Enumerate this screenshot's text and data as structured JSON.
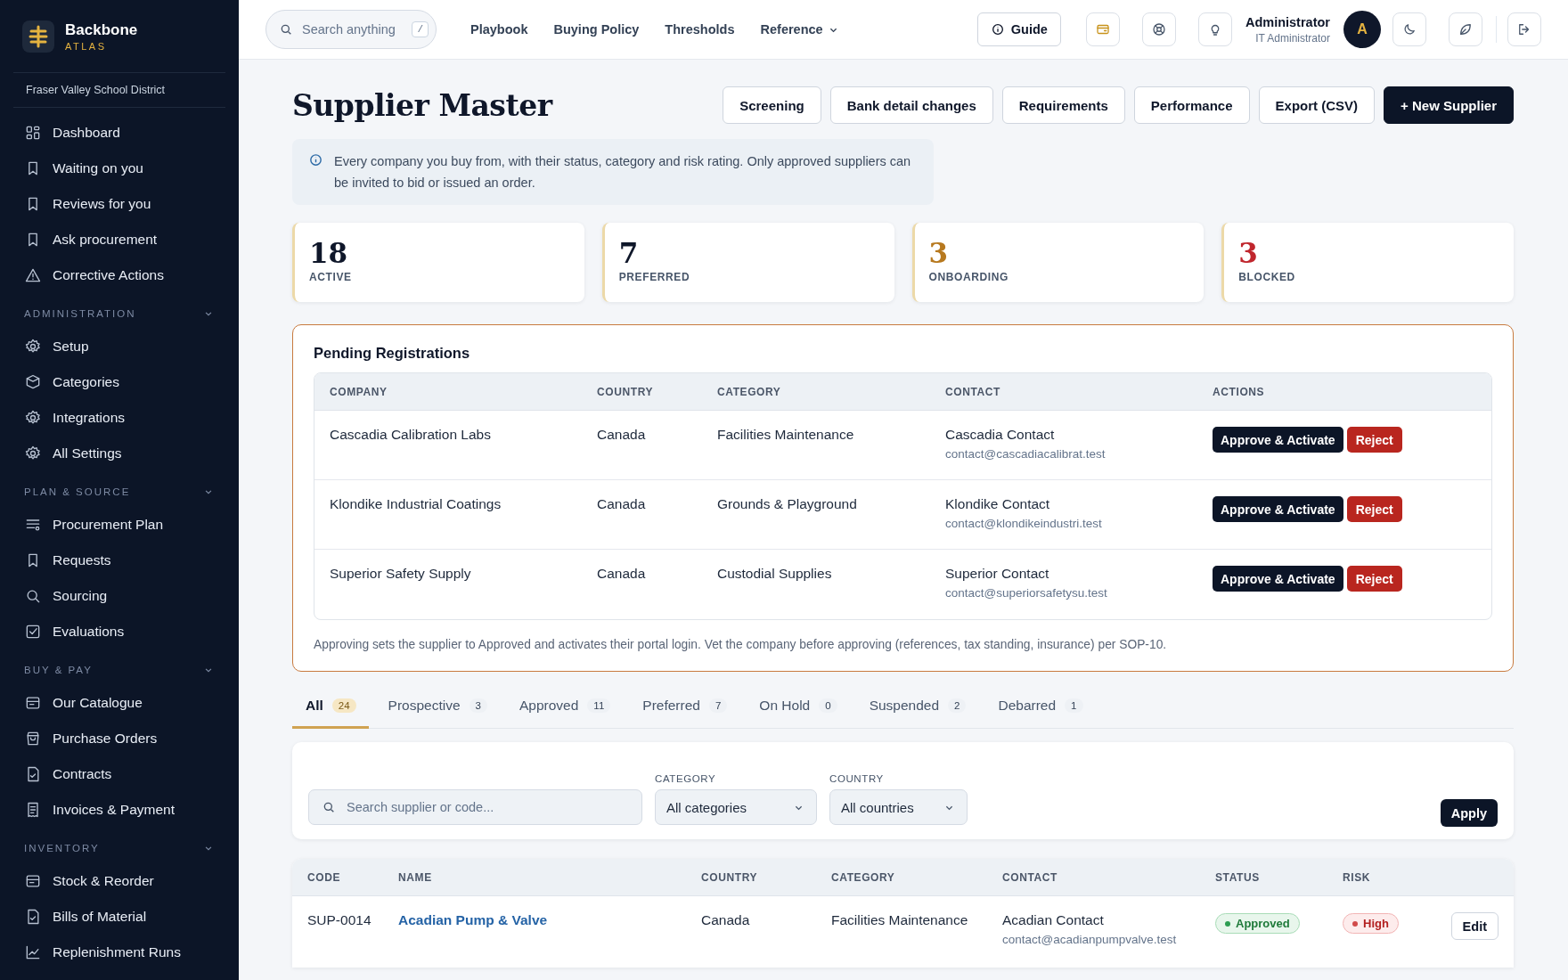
{
  "brand": {
    "name": "Backbone",
    "sub": "ATLAS"
  },
  "org": "Fraser Valley School District",
  "sidebar": {
    "items": [
      {
        "label": "Dashboard",
        "kind": "grid"
      },
      {
        "label": "Waiting on you",
        "kind": "bookmark"
      },
      {
        "label": "Reviews for you",
        "kind": "bookmark"
      },
      {
        "label": "Ask procurement",
        "kind": "bookmark"
      },
      {
        "label": "Corrective Actions",
        "kind": "alert"
      }
    ],
    "sections": [
      {
        "title": "ADMINISTRATION",
        "expanded": true,
        "items": [
          {
            "label": "Setup",
            "kind": "gear"
          },
          {
            "label": "Categories",
            "kind": "box"
          },
          {
            "label": "Integrations",
            "kind": "gear"
          },
          {
            "label": "All Settings",
            "kind": "gear"
          }
        ]
      },
      {
        "title": "PLAN & SOURCE",
        "expanded": true,
        "items": [
          {
            "label": "Procurement Plan",
            "kind": "list"
          },
          {
            "label": "Requests",
            "kind": "bookmark"
          },
          {
            "label": "Sourcing",
            "kind": "search"
          },
          {
            "label": "Evaluations",
            "kind": "check"
          }
        ]
      },
      {
        "title": "BUY & PAY",
        "expanded": true,
        "items": [
          {
            "label": "Our Catalogue",
            "kind": "card"
          },
          {
            "label": "Purchase Orders",
            "kind": "bag"
          },
          {
            "label": "Contracts",
            "kind": "doc"
          },
          {
            "label": "Invoices & Payment",
            "kind": "receipt"
          }
        ]
      },
      {
        "title": "INVENTORY",
        "expanded": true,
        "items": [
          {
            "label": "Stock & Reorder",
            "kind": "card"
          },
          {
            "label": "Bills of Material",
            "kind": "doc"
          },
          {
            "label": "Replenishment Runs",
            "kind": "chart"
          }
        ]
      }
    ]
  },
  "topbar": {
    "search": {
      "placeholder": "Search anything",
      "shortcut": "/"
    },
    "links": [
      {
        "label": "Playbook",
        "kind": "link"
      },
      {
        "label": "Buying Policy",
        "kind": "link"
      },
      {
        "label": "Thresholds",
        "kind": "link"
      },
      {
        "label": "Reference",
        "kind": "menu"
      }
    ],
    "guide": "Guide",
    "user": {
      "name": "Administrator",
      "role": "IT Administrator",
      "initial": "A"
    }
  },
  "page": {
    "title": "Supplier Master",
    "actions": [
      {
        "label": "Screening",
        "kind": "outline"
      },
      {
        "label": "Bank detail changes",
        "kind": "outline"
      },
      {
        "label": "Requirements",
        "kind": "outline"
      },
      {
        "label": "Performance",
        "kind": "outline"
      },
      {
        "label": "Export (CSV)",
        "kind": "outline"
      },
      {
        "label": "+ New Supplier",
        "kind": "primary"
      }
    ],
    "info": "Every company you buy from, with their status, category and risk rating. Only approved suppliers can be invited to bid or issued an order."
  },
  "stats": [
    {
      "value": "18",
      "label": "ACTIVE",
      "color": "#0f172a"
    },
    {
      "value": "7",
      "label": "PREFERRED",
      "color": "#0f172a"
    },
    {
      "value": "3",
      "label": "ONBOARDING",
      "color": "#b7791f"
    },
    {
      "value": "3",
      "label": "BLOCKED",
      "color": "#c0262d"
    }
  ],
  "pending": {
    "title": "Pending Registrations",
    "columns": [
      "COMPANY",
      "COUNTRY",
      "CATEGORY",
      "CONTACT",
      "ACTIONS"
    ],
    "rows": [
      {
        "company": "Cascadia Calibration Labs",
        "country": "Canada",
        "category": "Facilities Maintenance",
        "contact": "Cascadia Contact",
        "email": "contact@cascadiacalibrat.test",
        "approve": "Approve & Activate",
        "reject": "Reject"
      },
      {
        "company": "Klondike Industrial Coatings",
        "country": "Canada",
        "category": "Grounds & Playground",
        "contact": "Klondike Contact",
        "email": "contact@klondikeindustri.test",
        "approve": "Approve & Activate",
        "reject": "Reject"
      },
      {
        "company": "Superior Safety Supply",
        "country": "Canada",
        "category": "Custodial Supplies",
        "contact": "Superior Contact",
        "email": "contact@superiorsafetysu.test",
        "approve": "Approve & Activate",
        "reject": "Reject"
      }
    ],
    "note": "Approving sets the supplier to Approved and activates their portal login. Vet the company before approving (references, tax standing, insurance) per SOP-10."
  },
  "tabs": [
    {
      "label": "All",
      "count": "24",
      "selected": true
    },
    {
      "label": "Prospective",
      "count": "3",
      "selected": false
    },
    {
      "label": "Approved",
      "count": "11",
      "selected": false
    },
    {
      "label": "Preferred",
      "count": "7",
      "selected": false
    },
    {
      "label": "On Hold",
      "count": "0",
      "selected": false
    },
    {
      "label": "Suspended",
      "count": "2",
      "selected": false
    },
    {
      "label": "Debarred",
      "count": "1",
      "selected": false
    }
  ],
  "filters": {
    "search": {
      "placeholder": "Search supplier or code..."
    },
    "category": {
      "label": "CATEGORY",
      "value": "All categories"
    },
    "country": {
      "label": "COUNTRY",
      "value": "All countries"
    },
    "apply": "Apply"
  },
  "table": {
    "columns": [
      "CODE",
      "NAME",
      "COUNTRY",
      "CATEGORY",
      "CONTACT",
      "STATUS",
      "RISK"
    ],
    "rows": [
      {
        "code": "SUP-0014",
        "name": "Acadian Pump & Valve",
        "country": "Canada",
        "category": "Facilities Maintenance",
        "contact": "Acadian Contact",
        "email": "contact@acadianpumpvalve.test",
        "status": {
          "label": "Approved",
          "kind": "good"
        },
        "risk": {
          "label": "High",
          "kind": "bad"
        },
        "edit": "Edit"
      }
    ]
  }
}
